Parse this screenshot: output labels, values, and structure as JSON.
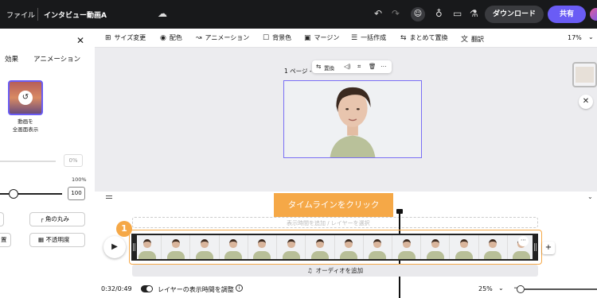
{
  "topbar": {
    "menu_label": "ファイル",
    "doc_title": "インタビュー動画A",
    "download_label": "ダウンロード",
    "share_label": "共有"
  },
  "left_panel": {
    "tabs": [
      "効果",
      "アニメーション"
    ],
    "thumb_label_line1": "動画を",
    "thumb_label_line2": "全画面表示",
    "pct_value": "0%",
    "max_label": "100%",
    "value_box": "100",
    "corner_button": "角の丸み",
    "opacity_button": "不透明度",
    "partial_button_left": "置"
  },
  "toolbar": {
    "items": [
      "サイズ変更",
      "配色",
      "アニメーション",
      "背景色",
      "マージン",
      "一括作成",
      "まとめて置換",
      "翻訳"
    ],
    "zoom": "17%"
  },
  "canvas": {
    "page_label": "1 ページ -",
    "replace_label": "置換"
  },
  "timeline": {
    "banner": "タイムラインをクリック",
    "badge": "1",
    "ghost_text": "表示時間を追加 / レイヤーを選択",
    "audio_label": "オーディオを追加",
    "time": "0:32/0:49",
    "toggle_label": "レイヤーの表示時間を調整",
    "zoom": "25%"
  },
  "colors": {
    "accent": "#6a5cf5",
    "highlight": "#f5a847",
    "topbar_bg": "#18191b"
  }
}
